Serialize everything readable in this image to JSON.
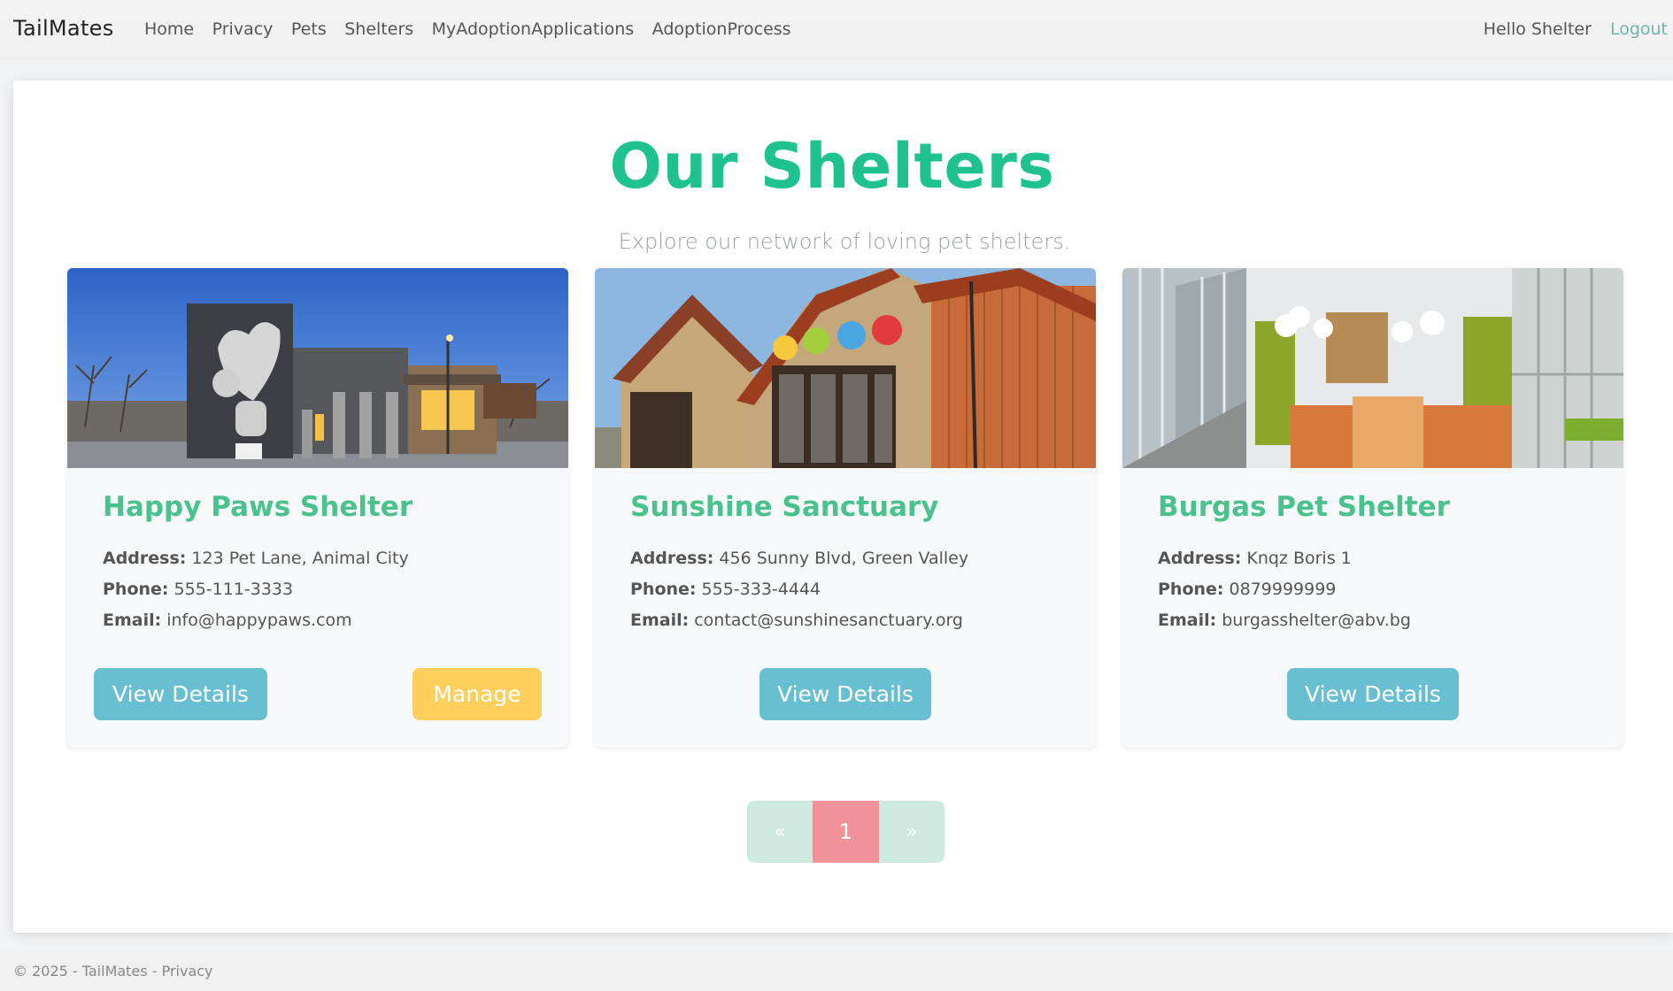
{
  "nav": {
    "brand": "TailMates",
    "links": [
      {
        "label": "Home"
      },
      {
        "label": "Privacy"
      },
      {
        "label": "Pets"
      },
      {
        "label": "Shelters"
      },
      {
        "label": "MyAdoptionApplications"
      },
      {
        "label": "AdoptionProcess"
      }
    ],
    "greeting": "Hello Shelter",
    "logout": "Logout"
  },
  "page": {
    "title": "Our Shelters",
    "subtitle": "Explore our network of loving pet shelters."
  },
  "labels": {
    "address": "Address:",
    "phone": "Phone:",
    "email": "Email:"
  },
  "shelters": [
    {
      "name": "Happy Paws Shelter",
      "address": "123 Pet Lane, Animal City",
      "phone": "555-111-3333",
      "email": "info@happypaws.com",
      "view_label": "View Details",
      "manage_label": "Manage"
    },
    {
      "name": "Sunshine Sanctuary",
      "address": "456 Sunny Blvd, Green Valley",
      "phone": "555-333-4444",
      "email": "contact@sunshinesanctuary.org",
      "view_label": "View Details"
    },
    {
      "name": "Burgas Pet Shelter",
      "address": "Knqz Boris 1",
      "phone": "0879999999",
      "email": "burgasshelter@abv.bg",
      "view_label": "View Details"
    }
  ],
  "pagination": {
    "prev": "«",
    "current": "1",
    "next": "»"
  },
  "footer": {
    "text": "© 2025 - TailMates - ",
    "privacy": "Privacy"
  },
  "colors": {
    "accent": "#1fc28e",
    "card_title": "#4bc28e",
    "btn_info": "#69bfd2",
    "btn_warning": "#fecf5c",
    "page_active": "#f2939a",
    "page_inactive": "#cde9e0"
  }
}
